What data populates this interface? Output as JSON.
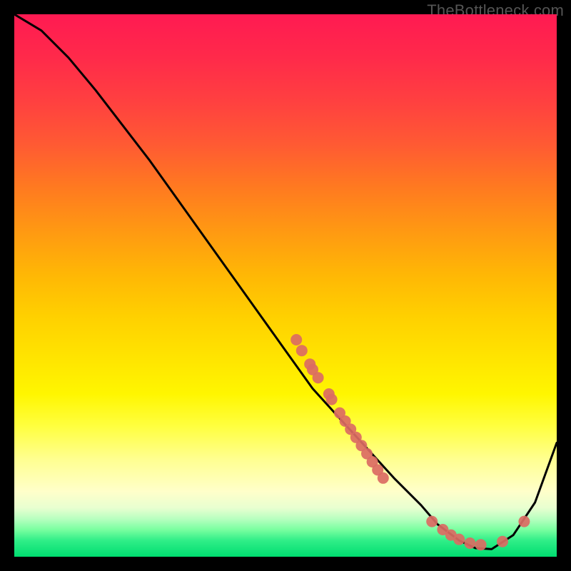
{
  "watermark": "TheBottleneck.com",
  "chart_data": {
    "type": "line",
    "title": "",
    "xlabel": "",
    "ylabel": "",
    "xlim": [
      0,
      100
    ],
    "ylim": [
      0,
      100
    ],
    "grid": false,
    "legend": false,
    "series": [
      {
        "name": "curve",
        "x": [
          0,
          5,
          10,
          15,
          20,
          25,
          30,
          35,
          40,
          45,
          50,
          55,
          60,
          65,
          70,
          75,
          78,
          82,
          85,
          88,
          92,
          96,
          100
        ],
        "y": [
          100,
          97,
          92,
          86,
          79.5,
          73,
          66,
          59,
          52,
          45,
          38,
          31,
          25.5,
          20,
          14.5,
          9.5,
          6,
          3,
          1.6,
          1.4,
          4,
          10,
          21
        ]
      }
    ],
    "points": [
      {
        "x": 52,
        "y": 40
      },
      {
        "x": 53,
        "y": 38
      },
      {
        "x": 54.5,
        "y": 35.5
      },
      {
        "x": 55,
        "y": 34.5
      },
      {
        "x": 56,
        "y": 33
      },
      {
        "x": 58,
        "y": 30
      },
      {
        "x": 58.5,
        "y": 29
      },
      {
        "x": 60,
        "y": 26.5
      },
      {
        "x": 61,
        "y": 25
      },
      {
        "x": 62,
        "y": 23.5
      },
      {
        "x": 63,
        "y": 22
      },
      {
        "x": 64,
        "y": 20.5
      },
      {
        "x": 65,
        "y": 19
      },
      {
        "x": 66,
        "y": 17.5
      },
      {
        "x": 67,
        "y": 16
      },
      {
        "x": 68,
        "y": 14.5
      },
      {
        "x": 77,
        "y": 6.5
      },
      {
        "x": 79,
        "y": 5
      },
      {
        "x": 80.5,
        "y": 4
      },
      {
        "x": 82,
        "y": 3.2
      },
      {
        "x": 84,
        "y": 2.5
      },
      {
        "x": 86,
        "y": 2.2
      },
      {
        "x": 90,
        "y": 2.8
      },
      {
        "x": 94,
        "y": 6.5
      }
    ],
    "colors": {
      "curve": "#000000",
      "points": "#db6b63"
    }
  }
}
